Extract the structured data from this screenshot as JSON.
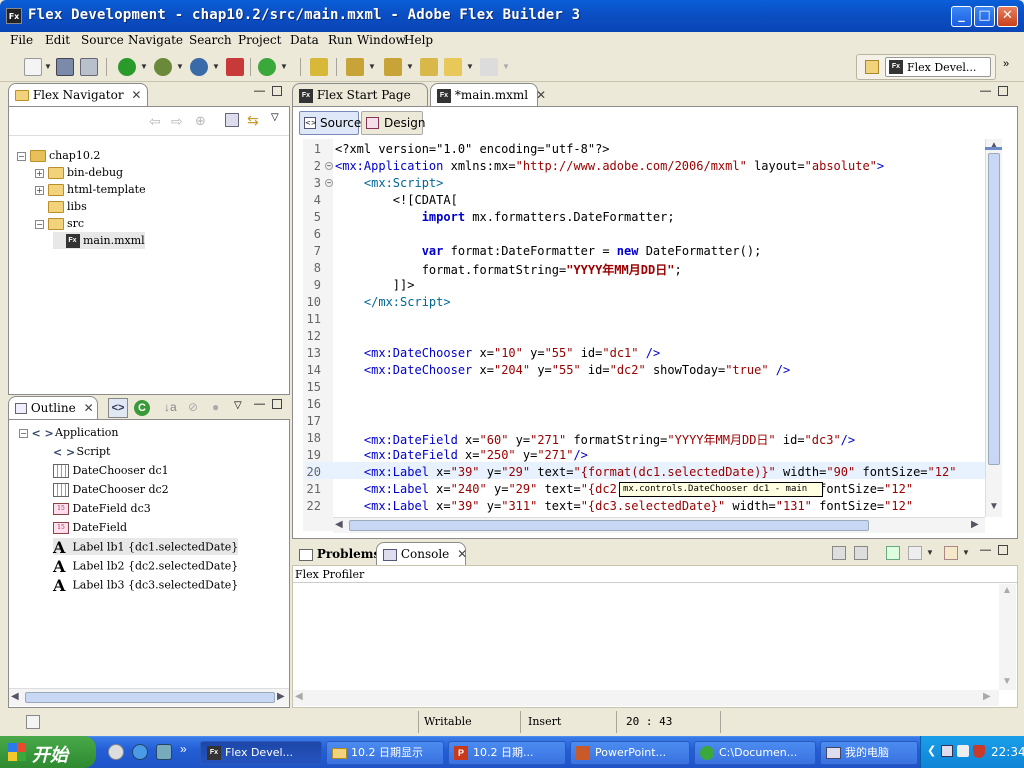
{
  "window": {
    "title": "Flex Development - chap10.2/src/main.mxml - Adobe Flex Builder 3",
    "app_icon": "Fx"
  },
  "menu": [
    "File",
    "Edit",
    "Source",
    "Navigate",
    "Search",
    "Project",
    "Data",
    "Run",
    "Window",
    "Help"
  ],
  "perspective": {
    "label": "Flex Devel..."
  },
  "navigator": {
    "tab": "Flex Navigator",
    "items": [
      {
        "label": "chap10.2",
        "indent": 0,
        "toggle": "-",
        "icon": "project"
      },
      {
        "label": "bin-debug",
        "indent": 1,
        "toggle": "+",
        "icon": "folder"
      },
      {
        "label": "html-template",
        "indent": 1,
        "toggle": "+",
        "icon": "folder"
      },
      {
        "label": "libs",
        "indent": 1,
        "toggle": "",
        "icon": "folder"
      },
      {
        "label": "src",
        "indent": 1,
        "toggle": "-",
        "icon": "folder"
      },
      {
        "label": "main.mxml",
        "indent": 2,
        "toggle": "",
        "icon": "fx-file"
      }
    ]
  },
  "outline": {
    "tab": "Outline",
    "items": [
      {
        "label": "Application",
        "icon": "tag"
      },
      {
        "label": "Script",
        "icon": "tag"
      },
      {
        "label": "DateChooser dc1",
        "icon": "calendar"
      },
      {
        "label": "DateChooser dc2",
        "icon": "calendar"
      },
      {
        "label": "DateField dc3",
        "icon": "datefield"
      },
      {
        "label": "DateField",
        "icon": "datefield"
      },
      {
        "label": "Label lb1 {dc1.selectedDate}",
        "icon": "label-a"
      },
      {
        "label": "Label lb2 {dc2.selectedDate}",
        "icon": "label-a"
      },
      {
        "label": "Label lb3 {dc3.selectedDate}",
        "icon": "label-a"
      }
    ]
  },
  "editor": {
    "tabs": [
      {
        "label": "Flex Start Page"
      },
      {
        "label": "*main.mxml"
      }
    ],
    "mode_buttons": {
      "source": "Source",
      "design": "Design"
    },
    "lines": [
      {
        "n": "1",
        "html": "<span class='a'>&lt;?xml version=&quot;1.0&quot; encoding=&quot;utf-8&quot;?&gt;</span>"
      },
      {
        "n": "2",
        "html": "<span class='k'>&lt;mx:Application</span> <span class='a'>xmlns:mx=</span><span class='s'>&quot;http://www.adobe.com/2006/mxml&quot;</span> <span class='a'>layout=</span><span class='s'>&quot;absolute&quot;</span><span class='k'>&gt;</span>"
      },
      {
        "n": "3",
        "html": "    <span class='t'>&lt;mx:Script&gt;</span>"
      },
      {
        "n": "4",
        "html": "        <span class='a'>&lt;![CDATA[</span>"
      },
      {
        "n": "5",
        "html": "            <span class='kw'>import</span> mx.formatters.DateFormatter;"
      },
      {
        "n": "6",
        "html": ""
      },
      {
        "n": "7",
        "html": "            <span class='kw'>var</span> format:DateFormatter = <span class='kw'>new</span> DateFormatter();"
      },
      {
        "n": "8",
        "html": "            format.formatString=<span class='s'><b>&quot;YYYY年MM月DD日&quot;</b></span>;"
      },
      {
        "n": "9",
        "html": "        <span class='a'>]]&gt;</span>"
      },
      {
        "n": "10",
        "html": "    <span class='t'>&lt;/mx:Script&gt;</span>"
      },
      {
        "n": "11",
        "html": ""
      },
      {
        "n": "12",
        "html": ""
      },
      {
        "n": "13",
        "html": "    <span class='k'>&lt;mx:DateChooser</span> x=<span class='s'>&quot;10&quot;</span> y=<span class='s'>&quot;55&quot;</span> id=<span class='s'>&quot;dc1&quot;</span> <span class='k'>/&gt;</span>"
      },
      {
        "n": "14",
        "html": "    <span class='k'>&lt;mx:DateChooser</span> x=<span class='s'>&quot;204&quot;</span> y=<span class='s'>&quot;55&quot;</span> id=<span class='s'>&quot;dc2&quot;</span> showToday=<span class='s'>&quot;true&quot;</span> <span class='k'>/&gt;</span>"
      },
      {
        "n": "15",
        "html": ""
      },
      {
        "n": "16",
        "html": ""
      },
      {
        "n": "17",
        "html": ""
      },
      {
        "n": "18",
        "html": "    <span class='k'>&lt;mx:DateField</span> x=<span class='s'>&quot;60&quot;</span> y=<span class='s'>&quot;271&quot;</span> formatString=<span class='s'>&quot;YYYY年MM月DD日&quot;</span> id=<span class='s'>&quot;dc3&quot;</span><span class='k'>/&gt;</span>"
      },
      {
        "n": "19",
        "html": "    <span class='k'>&lt;mx:DateField</span> x=<span class='s'>&quot;250&quot;</span> y=<span class='s'>&quot;271&quot;</span><span class='k'>/&gt;</span>"
      },
      {
        "n": "20",
        "html": "    <span class='k'>&lt;mx:Label</span> x=<span class='s'>&quot;39&quot;</span> y=<span class='s'>&quot;29&quot;</span> text=<span class='s'>&quot;{format(dc1.selectedDate)}&quot;</span> width=<span class='s'>&quot;90&quot;</span> fontSize=<span class='s'>&quot;12&quot;</span>"
      },
      {
        "n": "21",
        "html": "    <span class='k'>&lt;mx:Label</span> x=<span class='s'>&quot;240&quot;</span> y=<span class='s'>&quot;29&quot;</span> text=<span class='s'>&quot;{dc2.selectedDate}&quot;</span> width=<span class='s'>&quot;100&quot;</span> fontSize=<span class='s'>&quot;12&quot;</span>"
      },
      {
        "n": "22",
        "html": "    <span class='k'>&lt;mx:Label</span> x=<span class='s'>&quot;39&quot;</span> y=<span class='s'>&quot;311&quot;</span> text=<span class='s'>&quot;{dc3.selectedDate}&quot;</span> width=<span class='s'>&quot;131&quot;</span> fontSize=<span class='s'>&quot;12&quot;</span>"
      }
    ],
    "tooltip": "mx.controls.DateChooser dc1 - main"
  },
  "bottom": {
    "tabs": [
      {
        "label": "Problems"
      },
      {
        "label": "Console"
      }
    ],
    "content": "Flex Profiler"
  },
  "status": {
    "mode": "Writable",
    "insert": "Insert",
    "position": "20 : 43"
  },
  "taskbar": {
    "start": "开始",
    "tasks": [
      {
        "label": "Flex Devel..."
      },
      {
        "label": "10.2 日期显示"
      },
      {
        "label": "10.2 日期..."
      },
      {
        "label": "PowerPoint..."
      },
      {
        "label": "C:\\Documen..."
      },
      {
        "label": "我的电脑"
      }
    ],
    "clock": "22:34"
  },
  "colors": {
    "titlebar": "#0b4fc4",
    "taskbar": "#245ed6",
    "start": "#3a9a3c",
    "current_line": "#e8f2fe"
  }
}
